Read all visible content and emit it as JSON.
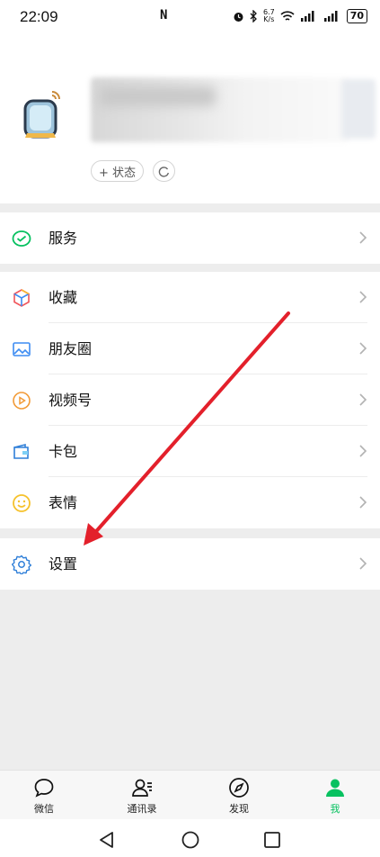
{
  "status_bar": {
    "time": "22:09",
    "net_speed_value": "6.7",
    "net_speed_unit": "K/s",
    "battery": "70"
  },
  "profile": {
    "status_button_label": "+ 状态"
  },
  "menu": {
    "service": "服务",
    "favorites": "收藏",
    "moments": "朋友圈",
    "channels": "视频号",
    "cards": "卡包",
    "stickers": "表情",
    "settings": "设置"
  },
  "tabs": {
    "chats": "微信",
    "contacts": "通讯录",
    "discover": "发现",
    "me": "我"
  },
  "colors": {
    "accent": "#07c160",
    "annotation_arrow": "#e3202b"
  }
}
